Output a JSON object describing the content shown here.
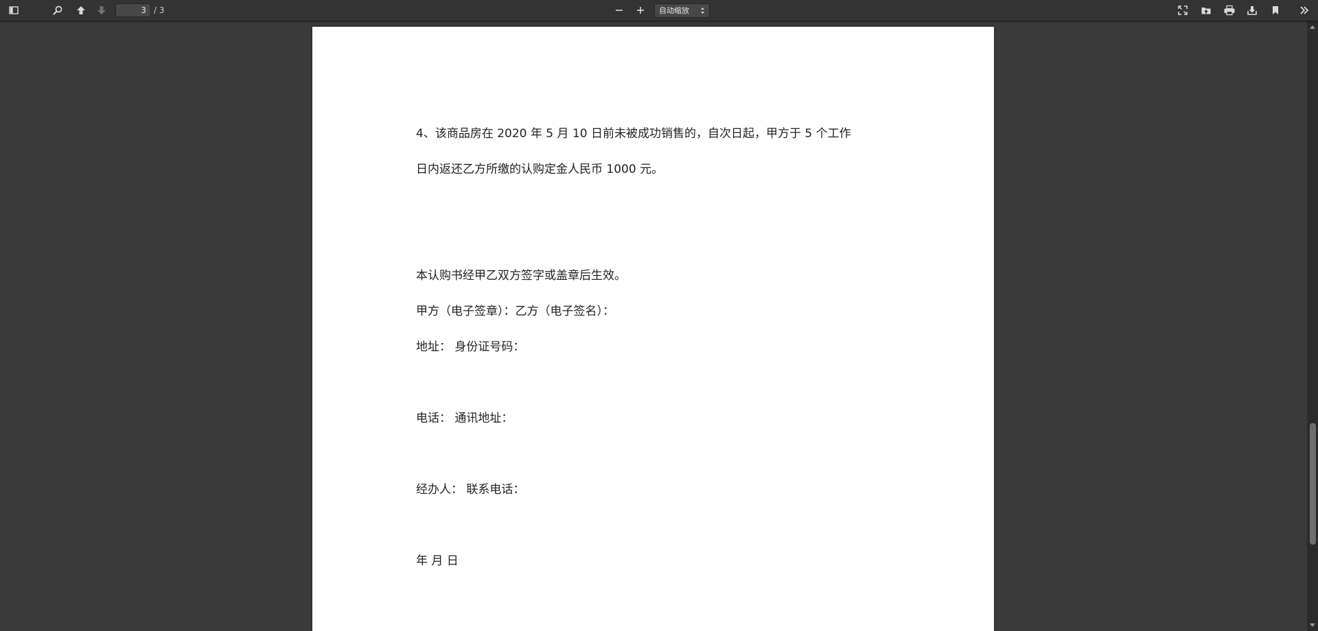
{
  "toolbar": {
    "page_number": "3",
    "page_count": "/ 3",
    "zoom_value": "自动缩放",
    "icons": {
      "sidebar_toggle": "sidebar-toggle-icon",
      "find": "search-icon",
      "previous_page": "arrow-up-icon",
      "next_page": "arrow-down-icon",
      "zoom_out": "minus-icon",
      "zoom_in": "plus-icon",
      "presentation": "fullscreen-icon",
      "open_file": "folder-open-icon",
      "print": "print-icon",
      "download": "download-icon",
      "bookmark": "bookmark-icon",
      "tools": "double-chevron-right-icon"
    }
  },
  "document": {
    "lines": [
      "4、该商品房在 2020 年 5 月 10 日前未被成功销售的，自次日起，甲方于 5 个工作",
      "日内返还乙方所缴的认购定金人民币 1000 元。",
      "本认购书经甲乙双方签字或盖章后生效。",
      "甲方（电子签章）：乙方（电子签名）：",
      "地址：  身份证号码：",
      "电话：  通讯地址：",
      "经办人：  联系电话：",
      "年  月  日"
    ]
  },
  "colors": {
    "toolbar_bg": "#333333",
    "viewer_bg": "#3a3a3a",
    "page_bg": "#ffffff",
    "text": "#222222",
    "icon": "#d9d9d9"
  }
}
